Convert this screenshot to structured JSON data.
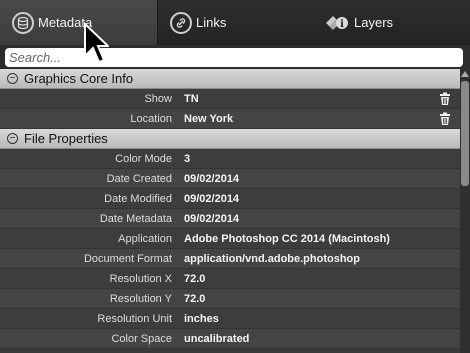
{
  "tabs": {
    "metadata": {
      "label": "Metadata",
      "icon": "database-icon"
    },
    "links": {
      "label": "Links",
      "icon": "link-icon"
    },
    "layers": {
      "label": "Layers",
      "icon": "layers-icon"
    }
  },
  "search": {
    "placeholder": "Search..."
  },
  "sections": {
    "graphics_core": {
      "title": "Graphics Core Info",
      "rows": [
        {
          "label": "Show",
          "value": "TN"
        },
        {
          "label": "Location",
          "value": "New York"
        }
      ]
    },
    "file_properties": {
      "title": "File Properties",
      "rows": [
        {
          "label": "Color Mode",
          "value": "3"
        },
        {
          "label": "Date Created",
          "value": "09/02/2014"
        },
        {
          "label": "Date Modified",
          "value": "09/02/2014"
        },
        {
          "label": "Date Metadata",
          "value": "09/02/2014"
        },
        {
          "label": "Application",
          "value": "Adobe Photoshop CC 2014 (Macintosh)"
        },
        {
          "label": "Document Format",
          "value": "application/vnd.adobe.photoshop"
        },
        {
          "label": "Resolution X",
          "value": "72.0"
        },
        {
          "label": "Resolution Y",
          "value": "72.0"
        },
        {
          "label": "Resolution Unit",
          "value": "inches"
        },
        {
          "label": "Color Space",
          "value": "uncalibrated"
        }
      ]
    }
  }
}
